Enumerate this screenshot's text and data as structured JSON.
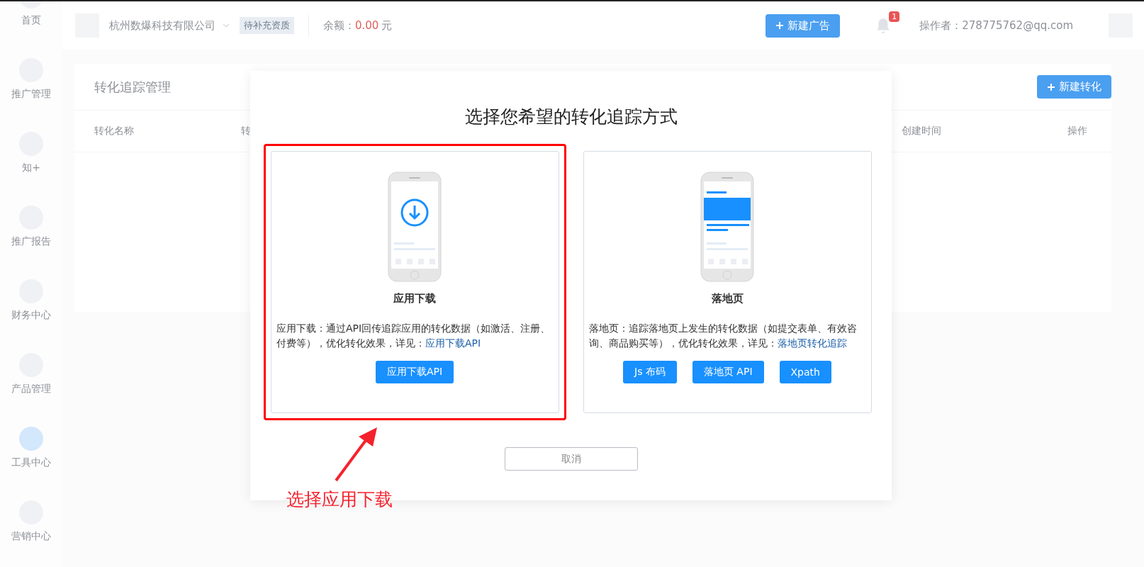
{
  "sidebar": {
    "items": [
      {
        "label": "首页",
        "selected": false
      },
      {
        "label": "推广管理",
        "selected": false
      },
      {
        "label": "知+",
        "selected": false
      },
      {
        "label": "推广报告",
        "selected": false
      },
      {
        "label": "财务中心",
        "selected": false
      },
      {
        "label": "产品管理",
        "selected": false
      },
      {
        "label": "工具中心",
        "selected": true
      },
      {
        "label": "营销中心",
        "selected": false
      }
    ]
  },
  "topbar": {
    "company": "杭州数爆科技有限公司",
    "status_badge": "待补充资质",
    "balance_label": "余额：",
    "balance_value": "0.00",
    "balance_unit": "元",
    "new_ad_button": "新建广告",
    "notification_count": "1",
    "operator": "操作者：278775762@qq.com"
  },
  "panel": {
    "title": "转化追踪管理",
    "new_button": "新建转化",
    "columns": [
      "转化名称",
      "转",
      "创建时间",
      "操作"
    ]
  },
  "modal": {
    "title": "选择您希望的转化追踪方式",
    "options": [
      {
        "kind": "app",
        "name": "应用下载",
        "description": "应用下载：通过API回传追踪应用的转化数据（如激活、注册、付费等），优化转化效果，详见：",
        "link": "应用下载API",
        "buttons": [
          "应用下载API"
        ],
        "highlighted": true
      },
      {
        "kind": "landing",
        "name": "落地页",
        "description": "落地页：追踪落地页上发生的转化数据（如提交表单、有效咨询、商品购买等），优化转化效果，详见：",
        "link": "落地页转化追踪",
        "buttons": [
          "Js 布码",
          "落地页 API",
          "Xpath"
        ],
        "highlighted": false
      }
    ],
    "cancel": "取消"
  },
  "annotation": {
    "text": "选择应用下载"
  }
}
